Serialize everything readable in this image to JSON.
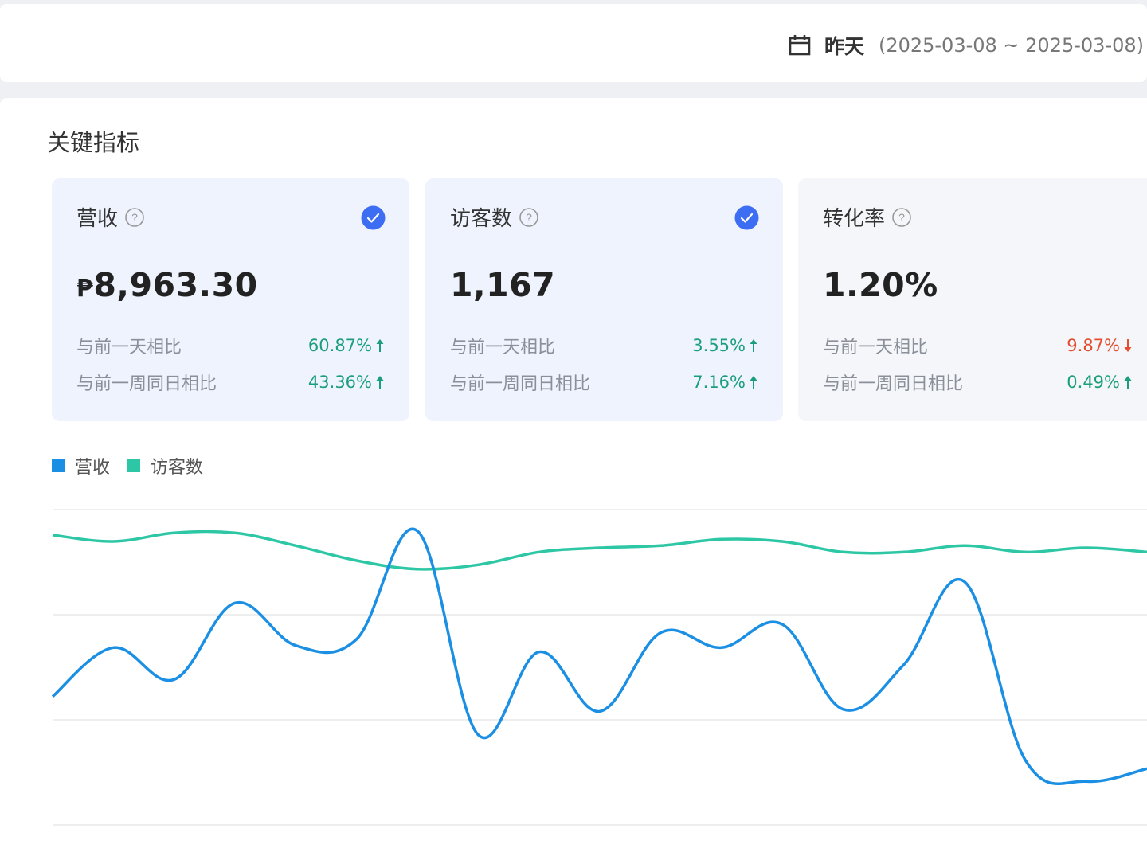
{
  "date_picker": {
    "label": "昨天",
    "range": "(2025-03-08 ~ 2025-03-08)"
  },
  "section_title": "关键指标",
  "cards": [
    {
      "title": "营收",
      "currency": "₱",
      "value": "8,963.30",
      "selected": true,
      "compare_day_label": "与前一天相比",
      "compare_day_value": "60.87%",
      "compare_day_trend": "up",
      "compare_week_label": "与前一周同日相比",
      "compare_week_value": "43.36%",
      "compare_week_trend": "up"
    },
    {
      "title": "访客数",
      "value": "1,167",
      "selected": true,
      "compare_day_label": "与前一天相比",
      "compare_day_value": "3.55%",
      "compare_day_trend": "up",
      "compare_week_label": "与前一周同日相比",
      "compare_week_value": "7.16%",
      "compare_week_trend": "up"
    },
    {
      "title": "转化率",
      "value": "1.20%",
      "selected": false,
      "compare_day_label": "与前一天相比",
      "compare_day_value": "9.87%",
      "compare_day_trend": "down",
      "compare_week_label": "与前一周同日相比",
      "compare_week_value": "0.49%",
      "compare_week_trend": "up"
    }
  ],
  "legend": [
    {
      "name": "营收",
      "color": "#1a8fe3"
    },
    {
      "name": "访客数",
      "color": "#2ec7a5"
    }
  ],
  "colors": {
    "up": "#1a9e7d",
    "down": "#e54d2e",
    "check": "#3d6df2",
    "revenue_line": "#1a8fe3",
    "visitors_line": "#2ec7a5",
    "grid": "#e8e8e8"
  },
  "chart_data": {
    "type": "line",
    "y_scale": "relative, no tick labels shown",
    "ylim": [
      0,
      100
    ],
    "grid": true,
    "legend": "top-left",
    "series": [
      {
        "name": "营收",
        "values": [
          62,
          85,
          70,
          106,
          86,
          89,
          140,
          44,
          83,
          55,
          92,
          85,
          96,
          56,
          77,
          116,
          32,
          22,
          28
        ]
      },
      {
        "name": "访客数",
        "values": [
          138,
          135,
          139,
          139,
          133,
          126,
          122,
          124,
          130,
          132,
          133,
          136,
          135,
          130,
          130,
          133,
          130,
          132,
          130
        ]
      }
    ]
  }
}
